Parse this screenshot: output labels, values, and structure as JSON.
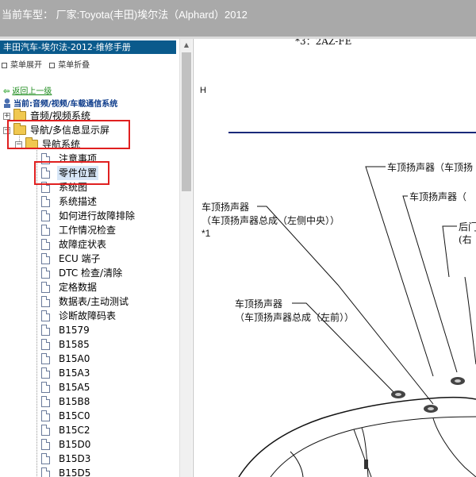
{
  "window": {
    "title": "当前车型： 厂家:Toyota(丰田)埃尔法（Alphard）2012"
  },
  "sidebar": {
    "manual_title": "丰田汽车-埃尔法-2012-维修手册",
    "toolbar": {
      "expand_label": "菜单展开",
      "collapse_label": "菜单折叠"
    },
    "back_label": "返回上一级",
    "current_label": "当前:音频/视频/车载通信系统",
    "tree": [
      {
        "label": "音频/视频系统",
        "type": "folder",
        "expander": "+"
      },
      {
        "label": "导航/多信息显示屏",
        "type": "folder",
        "expander": "-"
      },
      {
        "label": "导航系统",
        "type": "folder",
        "expander": "-"
      },
      {
        "label": "注意事项",
        "type": "doc"
      },
      {
        "label": "零件位置",
        "type": "doc",
        "selected": true
      },
      {
        "label": "系统图",
        "type": "doc"
      },
      {
        "label": "系统描述",
        "type": "doc"
      },
      {
        "label": "如何进行故障排除",
        "type": "doc"
      },
      {
        "label": "工作情况检查",
        "type": "doc"
      },
      {
        "label": "故障症状表",
        "type": "doc"
      },
      {
        "label": "ECU 端子",
        "type": "doc"
      },
      {
        "label": "DTC 检查/清除",
        "type": "doc"
      },
      {
        "label": "定格数据",
        "type": "doc"
      },
      {
        "label": "数据表/主动测试",
        "type": "doc"
      },
      {
        "label": "诊断故障码表",
        "type": "doc"
      },
      {
        "label": "B1579",
        "type": "doc"
      },
      {
        "label": "B1585",
        "type": "doc"
      },
      {
        "label": "B15A0",
        "type": "doc"
      },
      {
        "label": "B15A3",
        "type": "doc"
      },
      {
        "label": "B15A5",
        "type": "doc"
      },
      {
        "label": "B15B8",
        "type": "doc"
      },
      {
        "label": "B15C0",
        "type": "doc"
      },
      {
        "label": "B15C2",
        "type": "doc"
      },
      {
        "label": "B15D0",
        "type": "doc"
      },
      {
        "label": "B15D3",
        "type": "doc"
      },
      {
        "label": "B15D5",
        "type": "doc"
      }
    ]
  },
  "diagram": {
    "engine_note": "*3：2AZ-FE",
    "marker_h": "H",
    "callouts": {
      "roof_speaker_1": "车顶扬声器（车顶扬",
      "roof_speaker_2": "车顶扬声器（",
      "rear_door": "后门",
      "rear_door_sub": "(右",
      "roof_left_center_1": "车顶扬声器",
      "roof_left_center_2": "（车顶扬声器总成（左侧中央））",
      "note_1": "*1",
      "roof_left_front_1": "车顶扬声器",
      "roof_left_front_2": "（车顶扬声器总成（左前））"
    }
  }
}
